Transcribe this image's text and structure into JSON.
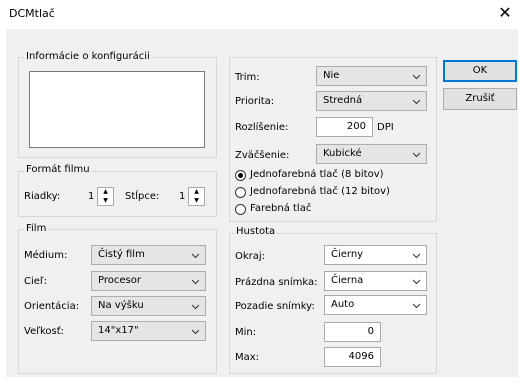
{
  "window": {
    "title": "DCMtlač",
    "close_glyph": "✕"
  },
  "buttons": {
    "ok": "OK",
    "cancel": "Zrušiť"
  },
  "config_info": {
    "legend": "Informácie o konfigurácii"
  },
  "film_format": {
    "legend": "Formát filmu",
    "rows_label": "Riadky:",
    "rows_value": "1",
    "cols_label": "Stĺpce:",
    "cols_value": "1"
  },
  "film": {
    "legend": "Film",
    "medium_label": "Médium:",
    "medium_value": "Čistý film",
    "target_label": "Cieľ:",
    "target_value": "Procesor",
    "orientation_label": "Orientácia:",
    "orientation_value": "Na výšku",
    "size_label": "Veľkosť:",
    "size_value": "14\"x17\""
  },
  "print_settings": {
    "trim_label": "Trim:",
    "trim_value": "Nie",
    "priority_label": "Priorita:",
    "priority_value": "Stredná",
    "resolution_label": "Rozlíšenie:",
    "resolution_value": "200",
    "resolution_unit": "DPI",
    "zoom_label": "Zväčšenie:",
    "zoom_value": "Kubické",
    "radio_mono8": "Jednofarebná tlač (8 bitov)",
    "radio_mono12": "Jednofarebná tlač (12 bitov)",
    "radio_color": "Farebná tlač",
    "selected_radio": "mono8"
  },
  "density": {
    "legend": "Hustota",
    "border_label": "Okraj:",
    "border_value": "Čierny",
    "empty_label": "Prázdna snímka:",
    "empty_value": "Čierna",
    "bg_label": "Pozadie snímky:",
    "bg_value": "Auto",
    "min_label": "Min:",
    "min_value": "0",
    "max_label": "Max:",
    "max_value": "4096"
  },
  "colors": {
    "accent": "#0078d7",
    "face": "#f0f0f0"
  }
}
